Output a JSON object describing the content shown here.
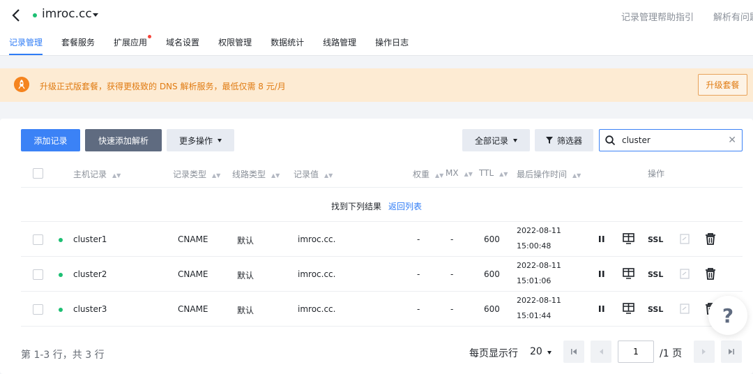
{
  "header": {
    "domain": "imroc.cc",
    "links": [
      "记录管理帮助指引",
      "解析有问题"
    ],
    "tabs": [
      {
        "label": "记录管理",
        "active": true
      },
      {
        "label": "套餐服务"
      },
      {
        "label": "扩展应用",
        "badge": true
      },
      {
        "label": "域名设置"
      },
      {
        "label": "权限管理"
      },
      {
        "label": "数据统计"
      },
      {
        "label": "线路管理"
      },
      {
        "label": "操作日志"
      }
    ]
  },
  "banner": {
    "text": "升级正式版套餐，获得更极致的 DNS 解析服务，最低仅需 8 元/月",
    "button": "升级套餐"
  },
  "toolbar": {
    "add": "添加记录",
    "quick_add": "快速添加解析",
    "more": "更多操作",
    "all_records": "全部记录",
    "filter": "筛选器",
    "search_value": "cluster"
  },
  "table": {
    "headers": {
      "host": "主机记录",
      "type": "记录类型",
      "line": "线路类型",
      "value": "记录值",
      "weight": "权重",
      "mx": "MX",
      "ttl": "TTL",
      "updated": "最后操作时间",
      "actions": "操作"
    },
    "found_text": "找到下列结果",
    "back_link": "返回列表",
    "rows": [
      {
        "host": "cluster1",
        "type": "CNAME",
        "line": "默认",
        "value": "imroc.cc.",
        "weight": "-",
        "mx": "-",
        "ttl": "600",
        "date": "2022-08-11",
        "time": "15:00:48",
        "ssl": "SSL"
      },
      {
        "host": "cluster2",
        "type": "CNAME",
        "line": "默认",
        "value": "imroc.cc.",
        "weight": "-",
        "mx": "-",
        "ttl": "600",
        "date": "2022-08-11",
        "time": "15:01:06",
        "ssl": "SSL"
      },
      {
        "host": "cluster3",
        "type": "CNAME",
        "line": "默认",
        "value": "imroc.cc.",
        "weight": "-",
        "mx": "-",
        "ttl": "600",
        "date": "2022-08-11",
        "time": "15:01:44",
        "ssl": "SSL"
      }
    ]
  },
  "pagination": {
    "summary": "第 1-3 行，共 3 行",
    "per_page_label": "每页显示行",
    "per_page": "20",
    "current_page": "1",
    "total_pages": "/1 页"
  },
  "help": {
    "label": "?"
  },
  "colors": {
    "primary": "#3b82f6",
    "status_green": "#1dbf73",
    "banner_orange": "#e07b12"
  }
}
